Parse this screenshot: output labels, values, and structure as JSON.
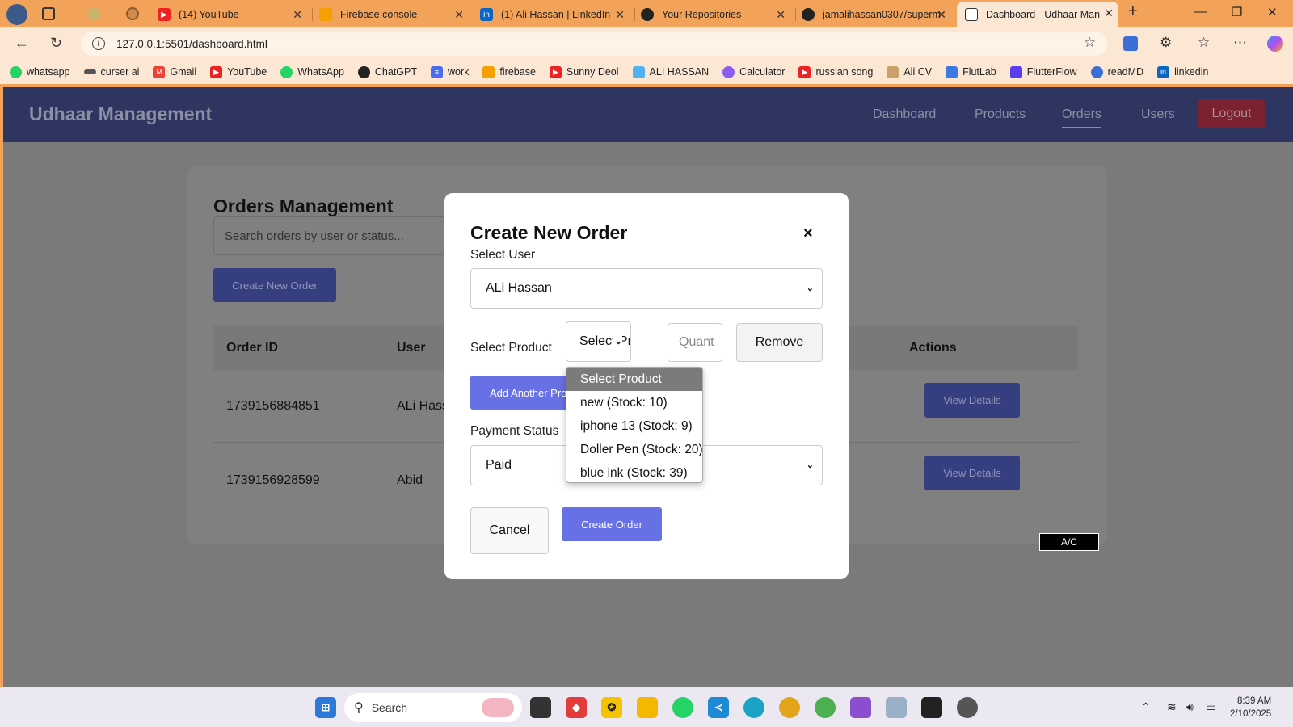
{
  "browser": {
    "tabs": [
      {
        "title": "(14) YouTube",
        "icon": "youtube-icon"
      },
      {
        "title": "Firebase console",
        "icon": "firebase-icon"
      },
      {
        "title": "(1) Ali Hassan | LinkedIn",
        "icon": "linkedin-icon"
      },
      {
        "title": "Your Repositories",
        "icon": "github-icon"
      },
      {
        "title": "jamalihassan0307/superm",
        "icon": "github-icon"
      },
      {
        "title": "Dashboard - Udhaar Man",
        "icon": "page-icon"
      }
    ],
    "url": "127.0.0.1:5501/dashboard.html",
    "bookmarks": [
      {
        "label": "whatsapp",
        "icon": "whatsapp-icon"
      },
      {
        "label": "curser ai",
        "icon": "cursor-icon"
      },
      {
        "label": "Gmail",
        "icon": "gmail-icon"
      },
      {
        "label": "YouTube",
        "icon": "youtube-icon"
      },
      {
        "label": "WhatsApp",
        "icon": "whatsapp-icon"
      },
      {
        "label": "ChatGPT",
        "icon": "chatgpt-icon"
      },
      {
        "label": "work",
        "icon": "docs-icon"
      },
      {
        "label": "firebase",
        "icon": "firebase-icon"
      },
      {
        "label": "Sunny Deol",
        "icon": "youtube-icon"
      },
      {
        "label": "ALI HASSAN",
        "icon": "flutter-icon"
      },
      {
        "label": "Calculator",
        "icon": "calculator-icon"
      },
      {
        "label": "russian song",
        "icon": "youtube-icon"
      },
      {
        "label": "Ali CV",
        "icon": "cv-icon"
      },
      {
        "label": "FlutLab",
        "icon": "flutlab-icon"
      },
      {
        "label": "FlutterFlow",
        "icon": "flutterflow-icon"
      },
      {
        "label": "readMD",
        "icon": "readmd-icon"
      },
      {
        "label": "linkedin",
        "icon": "linkedin-icon"
      }
    ]
  },
  "app": {
    "brand": "Udhaar Management",
    "nav": {
      "dashboard": "Dashboard",
      "products": "Products",
      "orders": "Orders",
      "users": "Users",
      "logout": "Logout"
    },
    "orders": {
      "title": "Orders Management",
      "search_placeholder": "Search orders by user or status...",
      "create_button": "Create New Order",
      "columns": {
        "order_id": "Order ID",
        "user": "User",
        "actions": "Actions"
      },
      "rows": [
        {
          "id": "1739156884851",
          "user": "ALi Hass",
          "action": "View Details"
        },
        {
          "id": "1739156928599",
          "user": "Abid",
          "action": "View Details"
        }
      ]
    },
    "badge": "A/C"
  },
  "modal": {
    "title": "Create New Order",
    "close_symbol": "×",
    "select_user_label": "Select User",
    "selected_user": "ALi Hassan",
    "select_product_label": "Select Product",
    "product_select_value": "Select Pr",
    "quantity_placeholder": "Quant",
    "remove_button": "Remove",
    "add_product_button": "Add Another Pro",
    "payment_status_label": "Payment Status",
    "payment_status_value": "Paid",
    "cancel_button": "Cancel",
    "create_button": "Create Order",
    "product_options": [
      "Select Product",
      "new (Stock: 10)",
      "iphone 13 (Stock: 9)",
      "Doller Pen (Stock: 20)",
      "blue ink (Stock: 39)"
    ]
  },
  "taskbar": {
    "search_label": "Search",
    "time": "8:39 AM",
    "date": "2/10/2025"
  },
  "colors": {
    "browser_frame": "#f3a25a",
    "navbar": "#2e3561",
    "primary_button": "#6770e4",
    "logout": "#c0392b",
    "overlay_background": "#7a7a7a"
  }
}
